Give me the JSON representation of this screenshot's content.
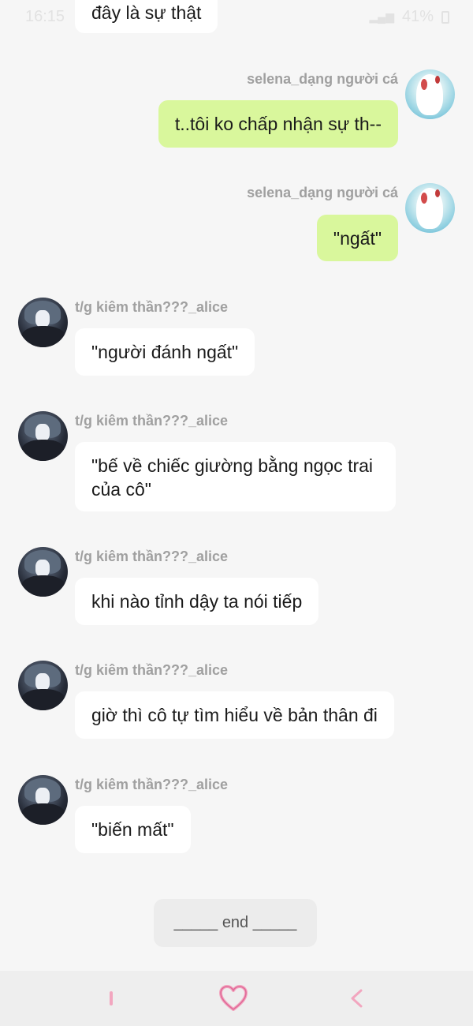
{
  "status_bar": {
    "time": "16:15",
    "battery": "41%"
  },
  "users": {
    "selena": "selena_dạng người cá",
    "alice": "t/g kiêm thần???_alice"
  },
  "messages": [
    {
      "sender": "alice",
      "text": "đây là sự thật"
    },
    {
      "sender": "selena",
      "text": "t..tôi ko chấp nhận sự th--"
    },
    {
      "sender": "selena",
      "text": "\"ngất\""
    },
    {
      "sender": "alice",
      "text": "\"người đánh ngất\""
    },
    {
      "sender": "alice",
      "text": "\"bế về chiếc giường bằng ngọc trai của cô\""
    },
    {
      "sender": "alice",
      "text": "khi nào tỉnh dậy ta nói tiếp"
    },
    {
      "sender": "alice",
      "text": "giờ thì cô tự tìm hiểu về bản thân đi"
    },
    {
      "sender": "alice",
      "text": "\"biến mất\""
    }
  ],
  "end_marker": "_____ end _____",
  "colors": {
    "bubble_self": "#d9f79c",
    "bubble_other": "#ffffff",
    "nav_accent": "#f2a6bf"
  },
  "icons": {
    "nav_recent": "recent-apps-icon",
    "nav_home": "heart-home-icon",
    "nav_back": "back-chevron-icon"
  }
}
